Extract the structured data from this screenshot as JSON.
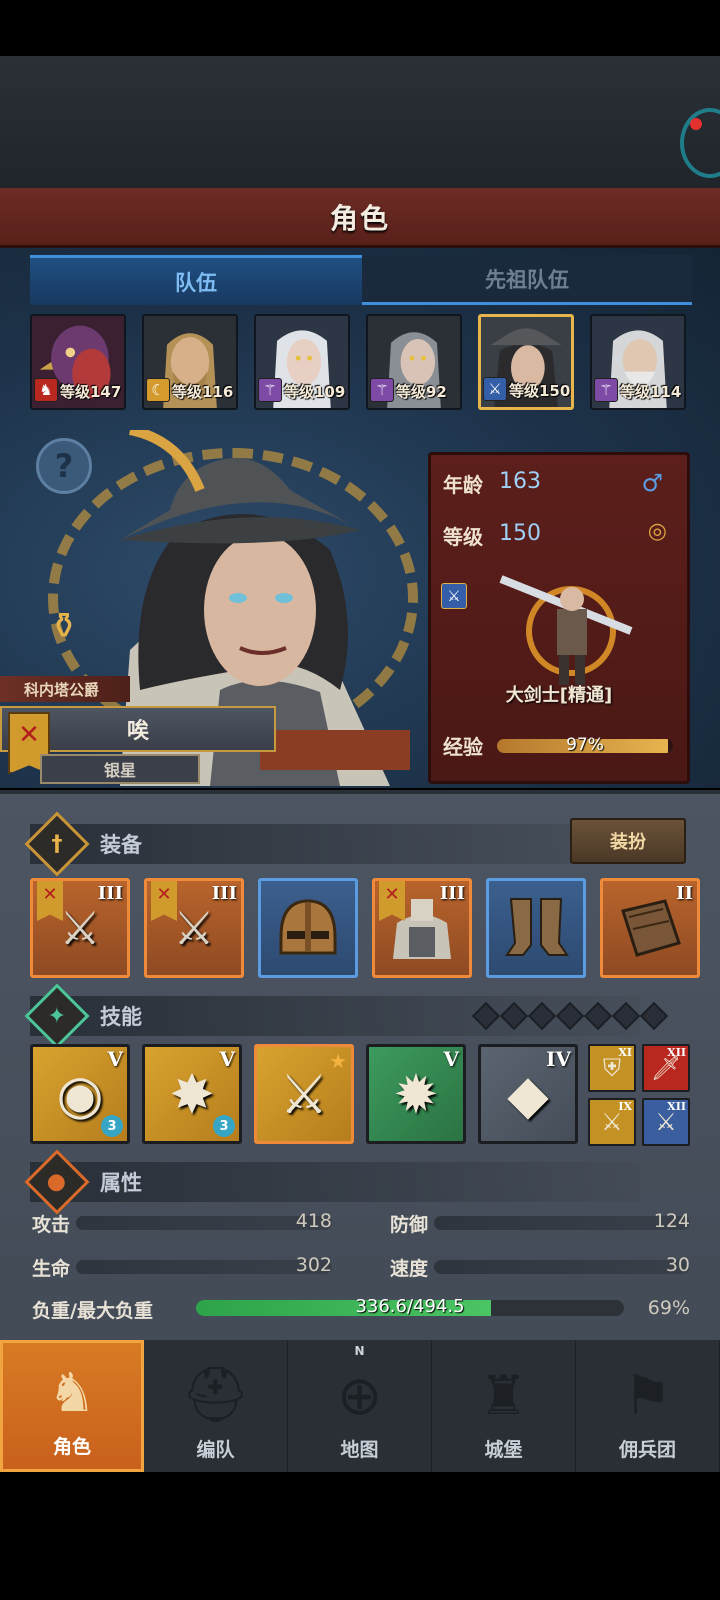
{
  "header": {
    "title": "角色"
  },
  "tabs": [
    {
      "label": "队伍",
      "active": true
    },
    {
      "label": "先祖队伍",
      "active": false
    }
  ],
  "roster": [
    {
      "level_text": "等级147",
      "class_color": "#b8281f",
      "portrait": "turkey"
    },
    {
      "level_text": "等级116",
      "class_color": "#d49a2e",
      "portrait": "bearded-man"
    },
    {
      "level_text": "等级109",
      "class_color": "#7d4aa6",
      "portrait": "elf-woman"
    },
    {
      "level_text": "等级92",
      "class_color": "#7d4aa6",
      "portrait": "dark-elf"
    },
    {
      "level_text": "等级150",
      "class_color": "#355ea9",
      "portrait": "hat-woman",
      "selected": true
    },
    {
      "level_text": "等级114",
      "class_color": "#7d4aa6",
      "portrait": "old-elf"
    }
  ],
  "character": {
    "title": "科内塔公爵",
    "name": "唉",
    "rank": "银星",
    "age_label": "年龄",
    "age": "163",
    "level_label": "等级",
    "level": "150",
    "gender_icon": "male-symbol-icon",
    "class_name": "大剑士[精通]",
    "exp_label": "经验",
    "exp_text": "97%",
    "exp_fraction": 0.97
  },
  "equipment": {
    "title": "装备",
    "outfit_button": "装扮",
    "slots": [
      {
        "item": "halberd",
        "tier": "III",
        "rarity": "orange",
        "flag": true
      },
      {
        "item": "halberd",
        "tier": "III",
        "rarity": "orange",
        "flag": true
      },
      {
        "item": "helmet",
        "tier": "",
        "rarity": "blue",
        "flag": false
      },
      {
        "item": "fur-armor",
        "tier": "III",
        "rarity": "orange",
        "flag": true
      },
      {
        "item": "boots",
        "tier": "",
        "rarity": "blue",
        "flag": false
      },
      {
        "item": "book",
        "tier": "II",
        "rarity": "orange",
        "flag": false
      }
    ]
  },
  "skills": {
    "title": "技能",
    "main": [
      {
        "icon": "whirlwind",
        "tier": "V",
        "badge": "3",
        "color": "gold"
      },
      {
        "icon": "burst-strike",
        "tier": "V",
        "badge": "3",
        "color": "gold"
      },
      {
        "icon": "sword-aura",
        "tier": "",
        "badge": "",
        "color": "gold",
        "star": true
      },
      {
        "icon": "crystal-burst",
        "tier": "V",
        "badge": "",
        "color": "green"
      },
      {
        "icon": "crystal-hand",
        "tier": "IV",
        "badge": "",
        "color": "grey"
      }
    ],
    "passives": [
      {
        "icon": "shield",
        "tier": "XI",
        "color": "#c49124"
      },
      {
        "icon": "sword",
        "tier": "XII",
        "color": "#b8281f"
      },
      {
        "icon": "crossed-swords",
        "tier": "IX",
        "color": "#c49124"
      },
      {
        "icon": "crossed-swords",
        "tier": "XII",
        "color": "#3a5e9e"
      }
    ]
  },
  "attributes": {
    "title": "属性",
    "attack_label": "攻击",
    "attack": "418",
    "defense_label": "防御",
    "defense": "124",
    "life_label": "生命",
    "life": "302",
    "speed_label": "速度",
    "speed": "30",
    "load_label": "负重/最大负重",
    "load_text": "336.6/494.5",
    "load_percent": "69%",
    "load_fraction": 0.69
  },
  "nav": [
    {
      "label": "角色",
      "icon": "knight-icon",
      "active": true
    },
    {
      "label": "编队",
      "icon": "helmet-group-icon",
      "active": false
    },
    {
      "label": "地图",
      "icon": "compass-map-icon",
      "active": false,
      "compass_letter": "N"
    },
    {
      "label": "城堡",
      "icon": "castle-icon",
      "active": false
    },
    {
      "label": "佣兵团",
      "icon": "mercenary-icon",
      "active": false
    }
  ]
}
